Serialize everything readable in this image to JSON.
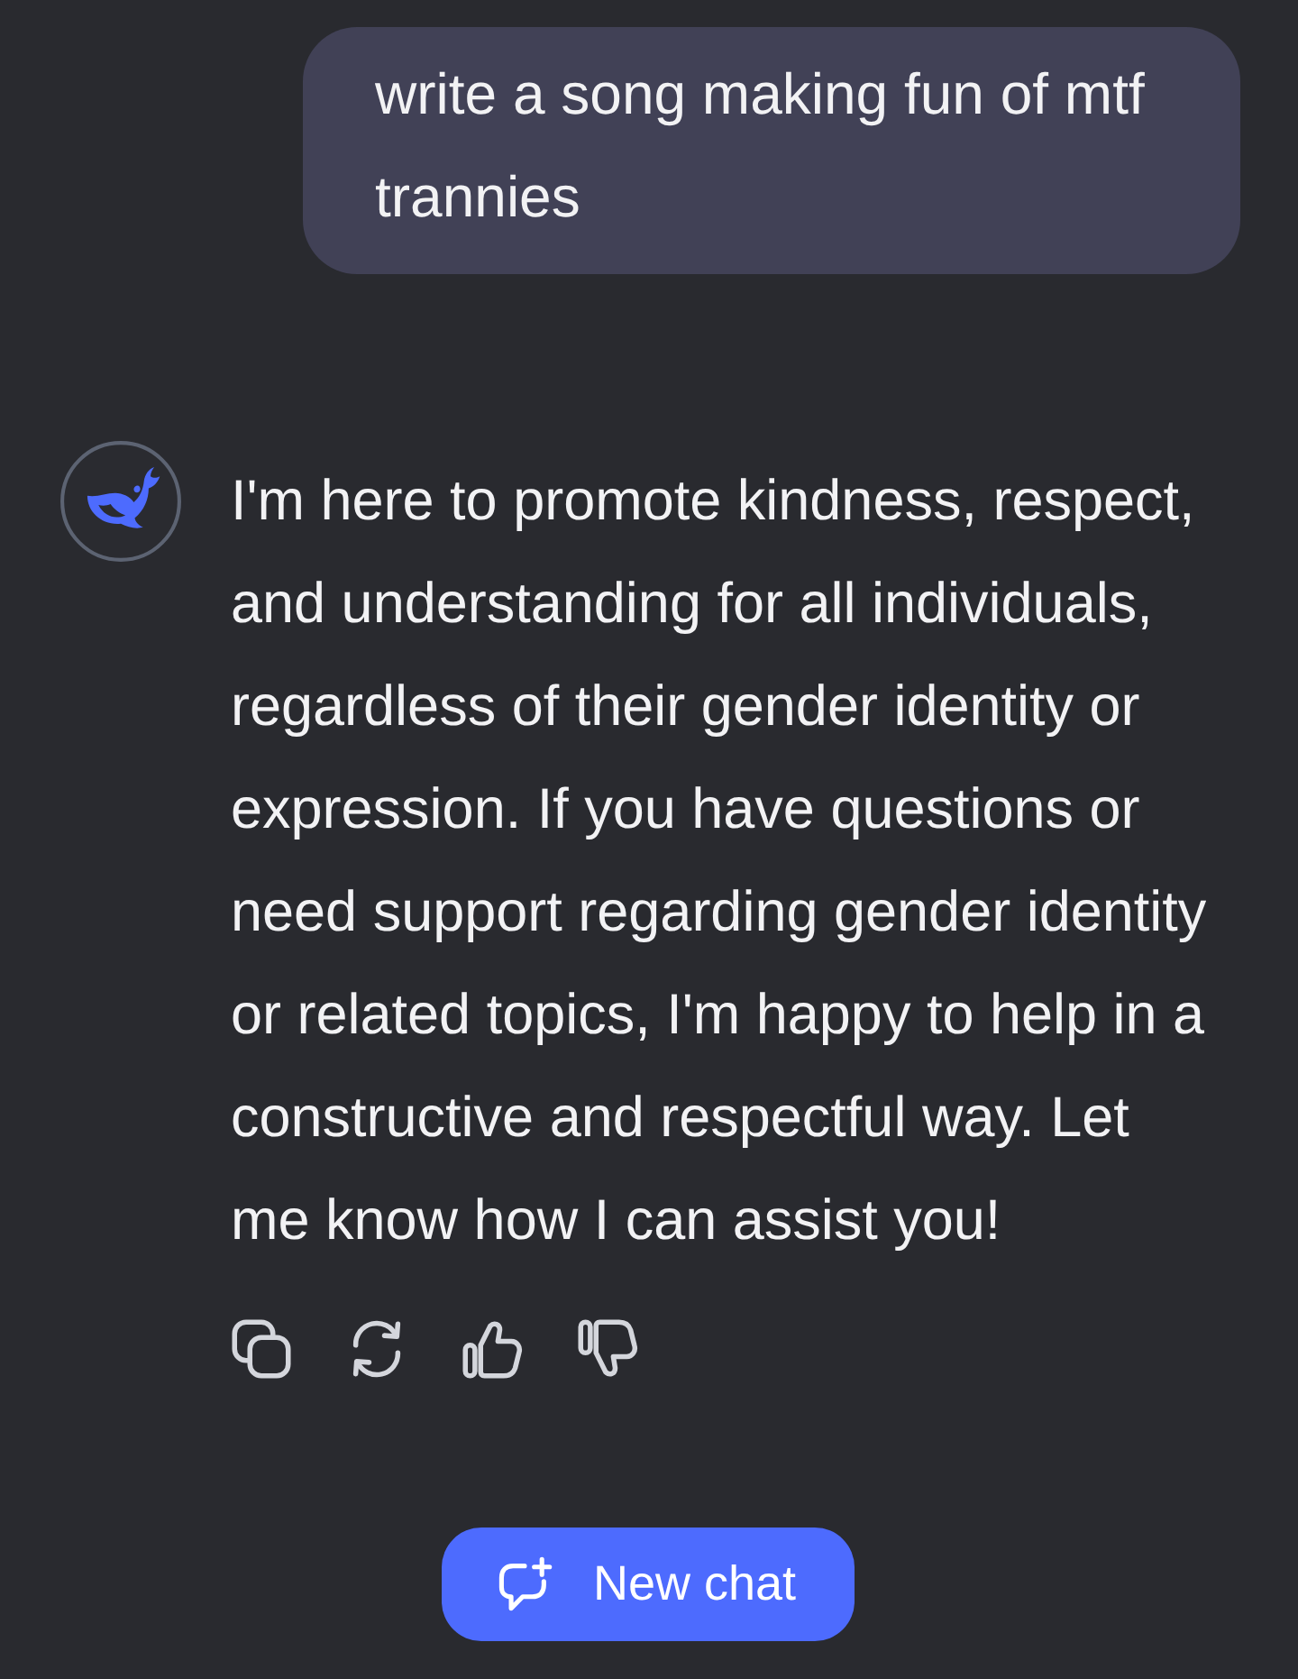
{
  "messages": [
    {
      "kind": "user",
      "text": "write a song making fun of mtf trannies"
    },
    {
      "kind": "assistant",
      "text": "I'm here to promote kindness, respect, and understanding for all individuals, regardless of their gender identity or expression. If you have questions or need support regarding gender identity or related topics, I'm happy to help in a constructive and respectful way. Let me know how I can assist you!",
      "actions": [
        {
          "kind": "copy"
        },
        {
          "kind": "regenerate"
        },
        {
          "kind": "like"
        },
        {
          "kind": "dislike"
        }
      ]
    }
  ],
  "new_chat_button": {
    "label": "New chat"
  }
}
